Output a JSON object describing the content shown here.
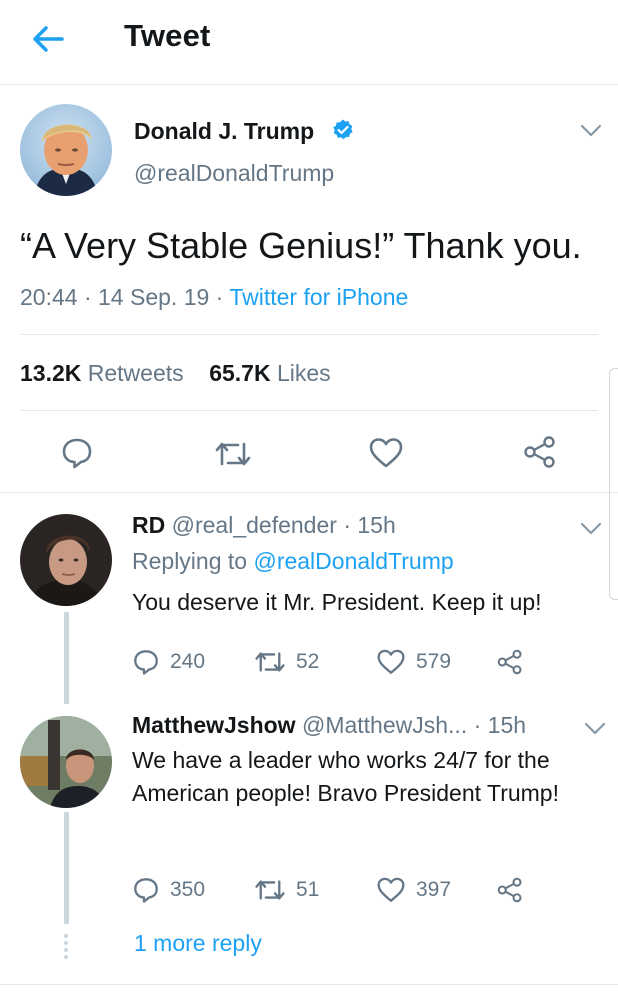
{
  "header": {
    "title": "Tweet",
    "back_icon": "arrow-left-icon"
  },
  "tweet": {
    "author_name": "Donald J. Trump",
    "author_handle": "@realDonaldTrump",
    "verified": true,
    "text": "“A Very Stable Genius!” Thank you.",
    "time": "20:44",
    "date": "14 Sep. 19",
    "separator": "·",
    "source": "Twitter for iPhone",
    "retweets_count": "13.2K",
    "retweets_label": "Retweets",
    "likes_count": "65.7K",
    "likes_label": "Likes",
    "actions": [
      "reply-icon",
      "retweet-icon",
      "heart-icon",
      "share-icon"
    ]
  },
  "replies": [
    {
      "name": "RD",
      "handle": "@real_defender",
      "separator": "·",
      "time": "15h",
      "replying_prefix": "Replying to",
      "replying_to": "@realDonaldTrump",
      "text": "You deserve it Mr. President. Keep it up!",
      "reply_count": "240",
      "retweet_count": "52",
      "like_count": "579"
    },
    {
      "name": "MatthewJshow",
      "handle": "@MatthewJsh...",
      "separator": "·",
      "time": "15h",
      "text": "We have a leader who works 24/7 for the American people! Bravo President Trump!",
      "reply_count": "350",
      "retweet_count": "51",
      "like_count": "397"
    }
  ],
  "more_reply": "1 more reply",
  "colors": {
    "accent": "#1da1f2",
    "muted": "#657786",
    "text": "#14171a",
    "line": "#ccd6dd"
  }
}
